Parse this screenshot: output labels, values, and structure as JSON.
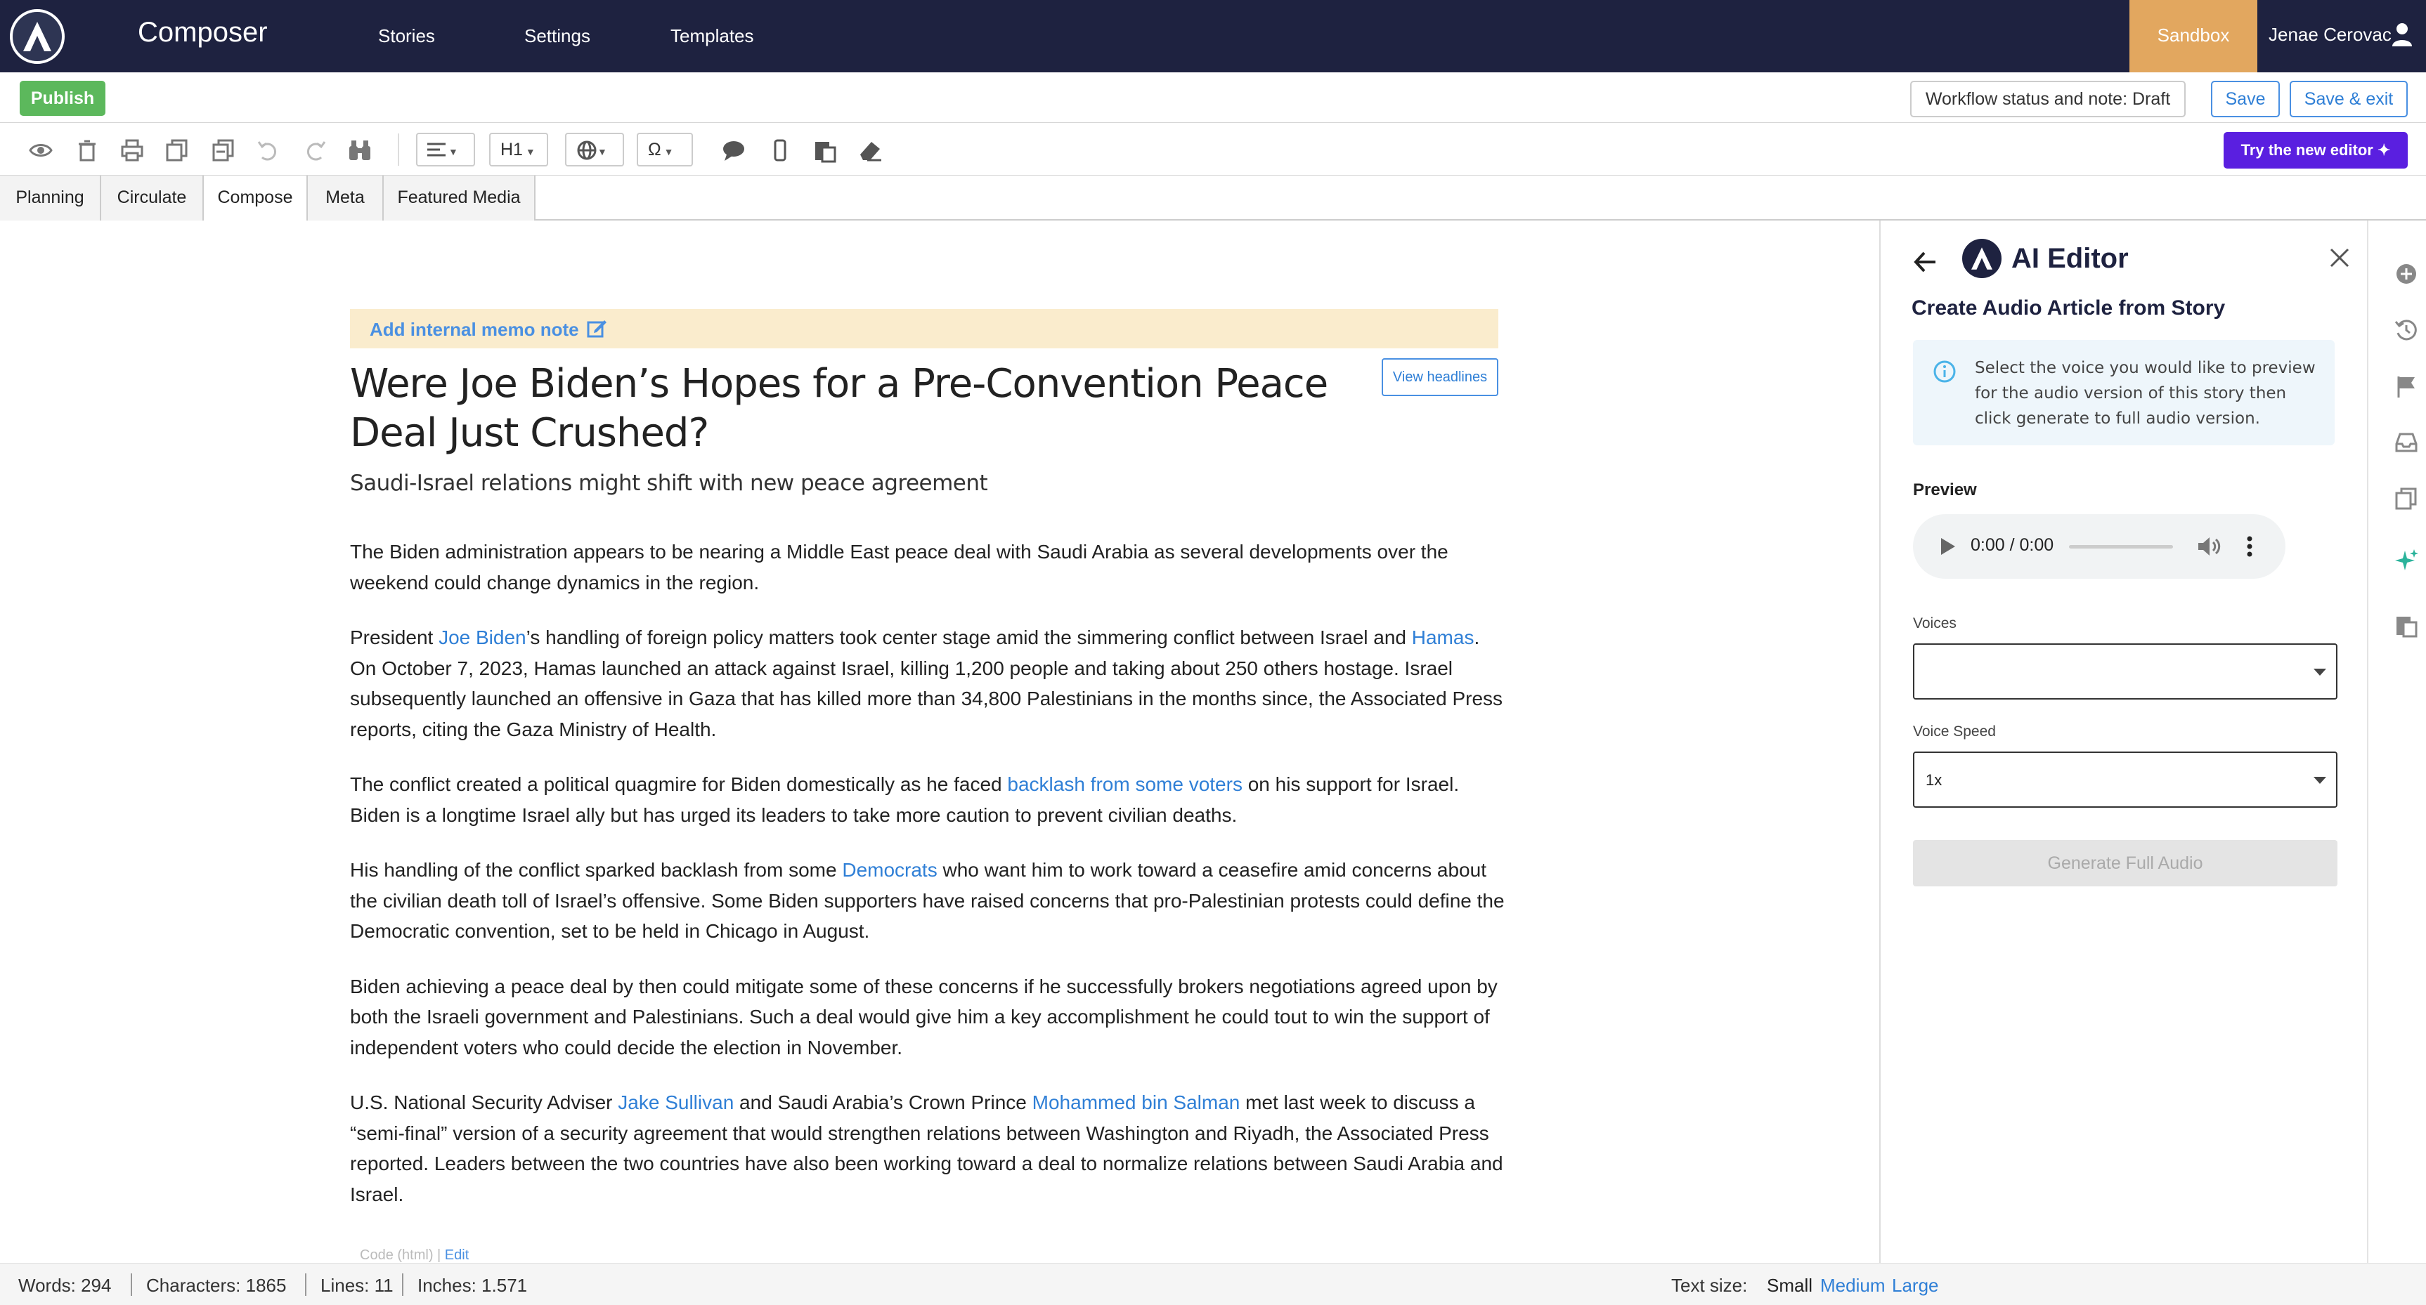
{
  "app": {
    "title": "Composer"
  },
  "nav": {
    "links": [
      "Stories",
      "Settings",
      "Templates"
    ]
  },
  "environment": "Sandbox",
  "user": {
    "name": "Jenae Cerovac"
  },
  "actions": {
    "publish": "Publish",
    "workflow": "Workflow status and note: Draft",
    "save": "Save",
    "save_exit": "Save & exit"
  },
  "toolbar": {
    "heading_select": "H1",
    "special_char": "Ω",
    "try_new_editor": "Try the new editor ✦"
  },
  "tabs": [
    "Planning",
    "Circulate",
    "Compose",
    "Meta",
    "Featured Media"
  ],
  "active_tab": "Compose",
  "memo": {
    "label": "Add internal memo note"
  },
  "view_headlines": "View headlines",
  "article": {
    "headline": "Were Joe Biden’s Hopes for a Pre-Convention Peace Deal Just Crushed?",
    "subheadline": "Saudi-Israel relations might shift with new peace agreement",
    "p1": "The Biden administration appears to be nearing a Middle East peace deal with Saudi Arabia as several developments over the weekend could change dynamics in the region.",
    "p2_a": "President ",
    "p2_link1": "Joe Biden",
    "p2_b": "’s handling of foreign policy matters took center stage amid the simmering conflict between Israel and ",
    "p2_link2": "Hamas",
    "p2_c": ". On October 7, 2023, Hamas launched an attack against Israel, killing 1,200 people and taking about 250 others hostage. Israel subsequently launched an offensive in Gaza that has killed more than 34,800 Palestinians in the months since, the Associated Press reports, citing the Gaza Ministry of Health.",
    "p3_a": "The conflict created a political quagmire for Biden domestically as he faced ",
    "p3_link": "backlash from some voters",
    "p3_b": " on his support for Israel. Biden is a longtime Israel ally but has urged its leaders to take more caution to prevent civilian deaths.",
    "p4_a": "His handling of the conflict sparked backlash from some ",
    "p4_link": "Democrats",
    "p4_b": " who want him to work toward a ceasefire amid concerns about the civilian death toll of Israel’s offensive. Some Biden supporters have raised concerns that pro-Palestinian protests could define the Democratic convention, set to be held in Chicago in August.",
    "p5": "Biden achieving a peace deal by then could mitigate some of these concerns if he successfully brokers negotiations agreed upon by both the Israeli government and Palestinians. Such a deal would give him a key accomplishment he could tout to win the support of independent voters who could decide the election in November.",
    "p6_a": "U.S. National Security Adviser ",
    "p6_link1": "Jake Sullivan",
    "p6_b": " and Saudi Arabia’s Crown Prince ",
    "p6_link2": "Mohammed bin Salman",
    "p6_c": " met last week to discuss a “semi-final” version of a security agreement that would strengthen relations between Washington and Riyadh, the Associated Press reported. Leaders between the two countries have also been working toward a deal to normalize relations between Saudi Arabia and Israel.",
    "code_label": "Code (html) | ",
    "code_edit": "Edit"
  },
  "ai_panel": {
    "title": "AI Editor",
    "heading": "Create Audio Article from Story",
    "info": "Select the voice you would like to preview for the audio version of this story then click generate to full audio version.",
    "preview_label": "Preview",
    "audio_time": "0:00 / 0:00",
    "voices_label": "Voices",
    "voices_value": "",
    "speed_label": "Voice Speed",
    "speed_value": "1x",
    "generate": "Generate Full Audio"
  },
  "status": {
    "words": "Words: 294",
    "characters": "Characters: 1865",
    "lines": "Lines: 11",
    "inches": "Inches: 1.571",
    "text_size_label": "Text size:",
    "sizes": [
      "Small",
      "Medium",
      "Large"
    ]
  },
  "colors": {
    "nav_bg": "#1e2240",
    "sandbox": "#e2a75f",
    "publish": "#5cb85c",
    "link": "#2f7fd6",
    "try_editor": "#5a1fe0",
    "memo_bg": "#faeccd"
  }
}
